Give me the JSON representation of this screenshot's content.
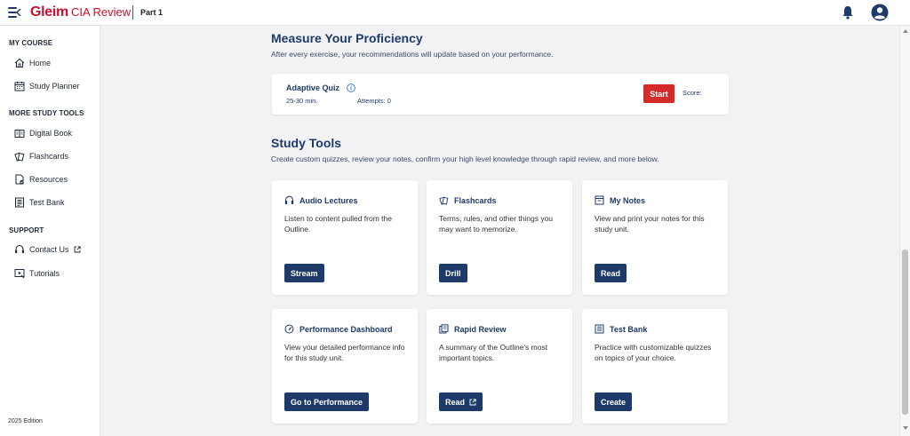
{
  "header": {
    "brand_name": "Gleim",
    "brand_product": "CIA Review",
    "part_label": "Part 1"
  },
  "sidebar": {
    "sections": [
      {
        "title": "MY COURSE",
        "items": [
          {
            "label": "Home",
            "icon": "home-icon"
          },
          {
            "label": "Study Planner",
            "icon": "calendar-icon"
          }
        ]
      },
      {
        "title": "MORE STUDY TOOLS",
        "items": [
          {
            "label": "Digital Book",
            "icon": "book-icon"
          },
          {
            "label": "Flashcards",
            "icon": "flashcards-icon"
          },
          {
            "label": "Resources",
            "icon": "resources-icon"
          },
          {
            "label": "Test Bank",
            "icon": "test-bank-icon"
          }
        ]
      },
      {
        "title": "SUPPORT",
        "items": [
          {
            "label": "Contact Us",
            "icon": "headset-icon"
          },
          {
            "label": "Tutorials",
            "icon": "tutorials-icon"
          }
        ]
      }
    ],
    "edition": "2025 Edition"
  },
  "main": {
    "proficiency": {
      "title": "Measure Your Proficiency",
      "subtitle": "After every exercise, your recommendations will update based on your performance."
    },
    "quiz": {
      "title": "Adaptive Quiz",
      "time": "25-30 min.",
      "attempts": "Attempts: 0",
      "start_label": "Start",
      "score_label": "Score:"
    },
    "study_tools": {
      "title": "Study Tools",
      "subtitle": "Create custom quizzes, review your notes, confirm your high level knowledge through rapid review, and more below.",
      "cards": [
        {
          "title": "Audio Lectures",
          "icon": "headphones-icon",
          "description": "Listen to content pulled from the Outline.",
          "button": "Stream",
          "external": false
        },
        {
          "title": "Flashcards",
          "icon": "flashcards-icon",
          "description": "Terms, rules, and other things you may want to memorize.",
          "button": "Drill",
          "external": false
        },
        {
          "title": "My Notes",
          "icon": "notes-icon",
          "description": "View and print your notes for this study unit.",
          "button": "Read",
          "external": false
        },
        {
          "title": "Performance Dashboard",
          "icon": "gauge-icon",
          "description": "View your detailed performance info for this study unit.",
          "button": "Go to Performance",
          "external": false
        },
        {
          "title": "Rapid Review",
          "icon": "rapid-review-icon",
          "description": "A summary of the Outline's most important topics.",
          "button": "Read",
          "external": true
        },
        {
          "title": "Test Bank",
          "icon": "test-bank-icon",
          "description": "Practice with customizable quizzes on topics of your choice.",
          "button": "Create",
          "external": false
        }
      ]
    }
  },
  "colors": {
    "brand_red": "#c8102e",
    "navy": "#1e3a6b",
    "start_red": "#d42a2a",
    "background": "#f2f2f4"
  }
}
